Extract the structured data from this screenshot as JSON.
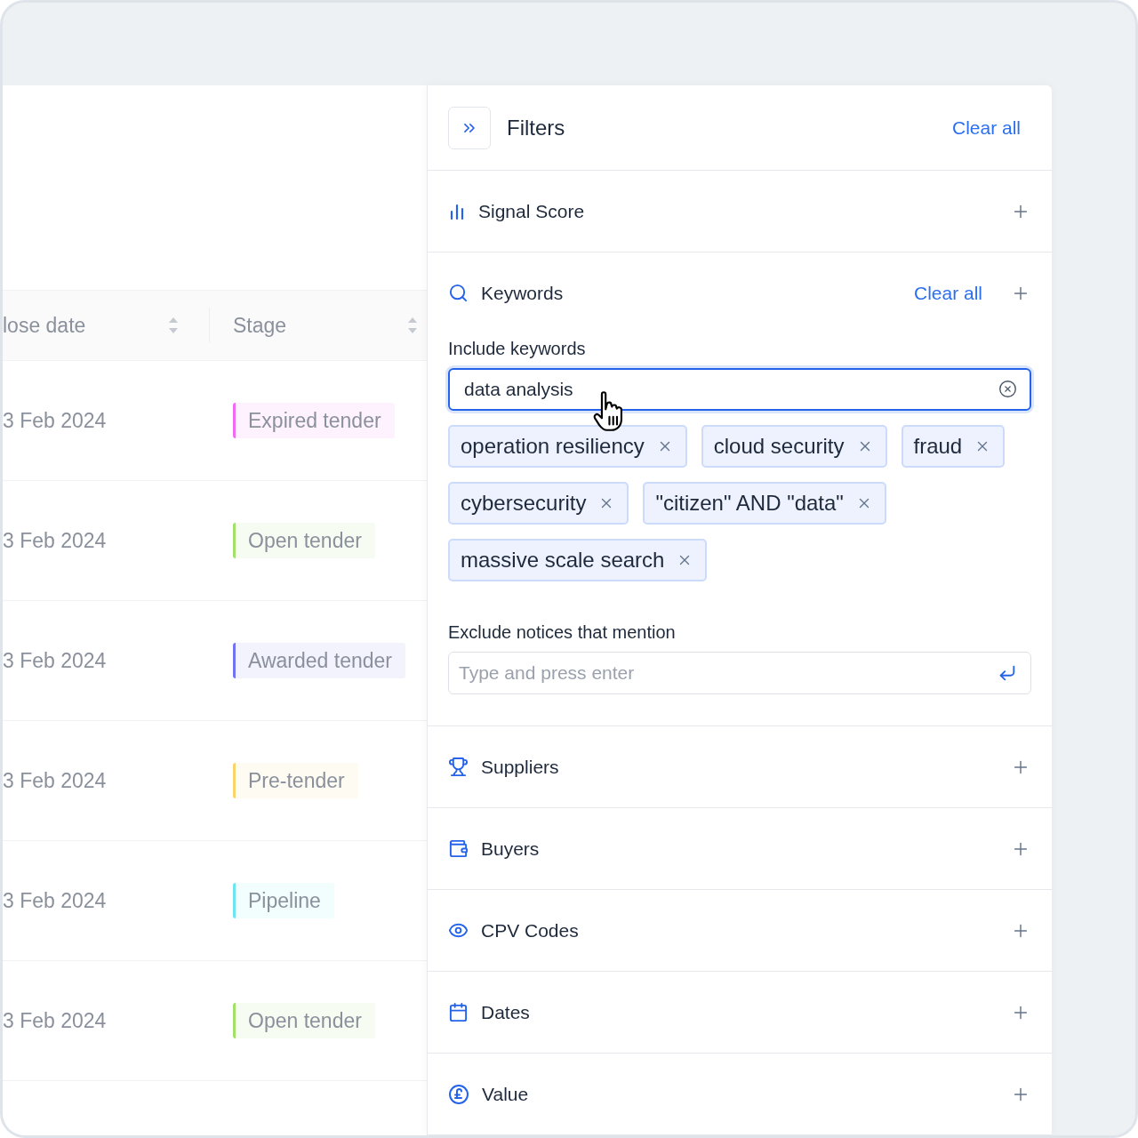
{
  "table": {
    "columns": [
      {
        "label": "lose date"
      },
      {
        "label": "Stage"
      }
    ],
    "rows": [
      {
        "close_date": "3 Feb 2024",
        "stage": {
          "label": "Expired tender",
          "color": "#ef6cf0"
        }
      },
      {
        "close_date": "3 Feb 2024",
        "stage": {
          "label": "Open tender",
          "color": "#a3e06a"
        }
      },
      {
        "close_date": "3 Feb 2024",
        "stage": {
          "label": "Awarded tender",
          "color": "#7173f2"
        }
      },
      {
        "close_date": "3 Feb 2024",
        "stage": {
          "label": "Pre-tender",
          "color": "#f9d46b"
        }
      },
      {
        "close_date": "3 Feb 2024",
        "stage": {
          "label": "Pipeline",
          "color": "#6ee4ee"
        }
      },
      {
        "close_date": "3 Feb 2024",
        "stage": {
          "label": "Open tender",
          "color": "#a3e06a"
        }
      }
    ]
  },
  "filters": {
    "title": "Filters",
    "clear_all": "Clear all",
    "sections": [
      {
        "title": "Signal Score"
      },
      {
        "title": "Keywords",
        "clear_all": "Clear all",
        "include_label": "Include keywords",
        "include_value": "data analysis",
        "keywords": [
          "operation resiliency",
          "cloud security",
          "fraud",
          "cybersecurity",
          "\"citizen\" AND \"data\"",
          "massive scale search"
        ],
        "exclude_label": "Exclude notices that mention",
        "exclude_placeholder": "Type and press enter"
      },
      {
        "title": "Suppliers"
      },
      {
        "title": "Buyers"
      },
      {
        "title": "CPV Codes"
      },
      {
        "title": "Dates"
      },
      {
        "title": "Value"
      }
    ]
  }
}
